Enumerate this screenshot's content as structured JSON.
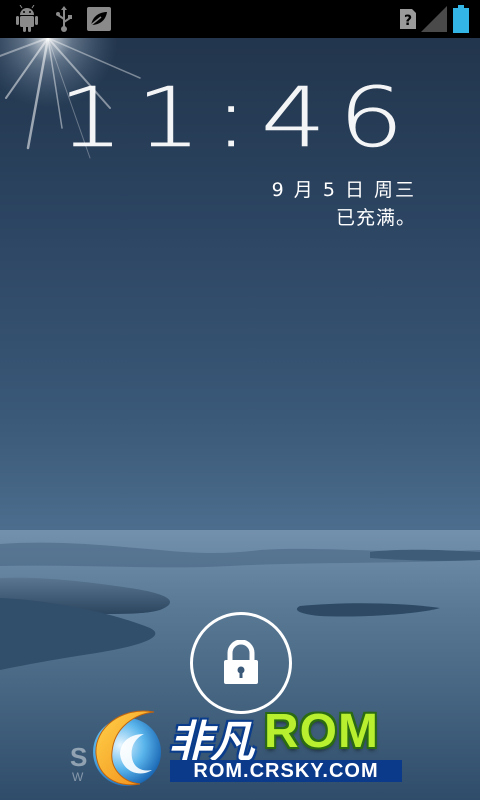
{
  "status_bar": {
    "left_icons": [
      "android-debug-icon",
      "usb-icon",
      "leaf-icon"
    ],
    "right_icons": [
      "unknown-sim-icon",
      "signal-icon",
      "battery-icon"
    ]
  },
  "lockscreen": {
    "time": "11:46",
    "date": "9 月 5 日 周三",
    "charge_status": "已充满。",
    "unlock_icon": "lock-icon"
  },
  "watermark": {
    "brand_cn": "非凡",
    "brand_rom": "ROM",
    "url": "ROM.CRSKY.COM",
    "faint_text": "S",
    "faint_sub": "W"
  },
  "colors": {
    "status_bar": "#000000",
    "wallpaper_top": "#203248",
    "wallpaper_mid": "#4c6d8d",
    "battery": "#33b5e5",
    "rom_green": "#b8ef2f",
    "url_bg": "#0c3a8a"
  }
}
